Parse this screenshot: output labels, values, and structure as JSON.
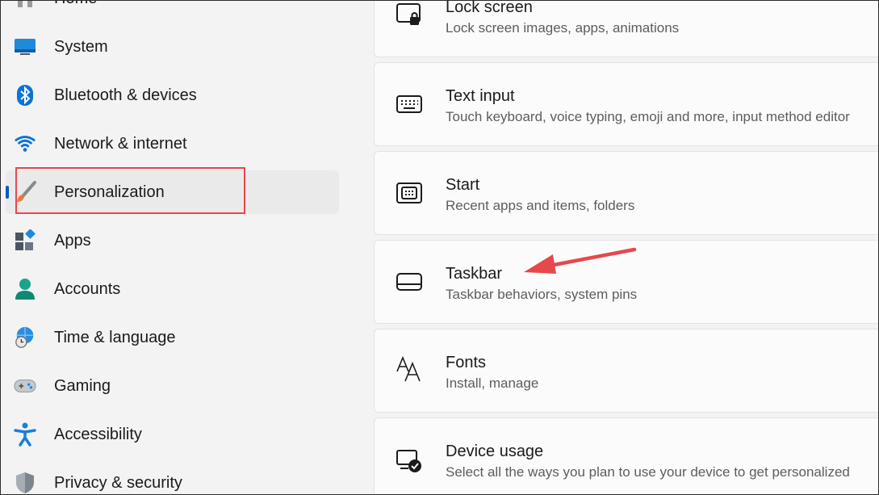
{
  "sidebar": {
    "items": [
      {
        "label": "Home",
        "icon": "home-icon"
      },
      {
        "label": "System",
        "icon": "system-icon"
      },
      {
        "label": "Bluetooth & devices",
        "icon": "bluetooth-icon"
      },
      {
        "label": "Network & internet",
        "icon": "wifi-icon"
      },
      {
        "label": "Personalization",
        "icon": "paintbrush-icon",
        "selected": true
      },
      {
        "label": "Apps",
        "icon": "apps-icon"
      },
      {
        "label": "Accounts",
        "icon": "accounts-icon"
      },
      {
        "label": "Time & language",
        "icon": "globe-clock-icon"
      },
      {
        "label": "Gaming",
        "icon": "gamepad-icon"
      },
      {
        "label": "Accessibility",
        "icon": "accessibility-icon"
      },
      {
        "label": "Privacy & security",
        "icon": "shield-icon"
      }
    ]
  },
  "main": {
    "cards": [
      {
        "title": "Lock screen",
        "description": "Lock screen images, apps, animations",
        "icon": "lock-screen-icon"
      },
      {
        "title": "Text input",
        "description": "Touch keyboard, voice typing, emoji and more, input method editor",
        "icon": "keyboard-icon"
      },
      {
        "title": "Start",
        "description": "Recent apps and items, folders",
        "icon": "start-icon"
      },
      {
        "title": "Taskbar",
        "description": "Taskbar behaviors, system pins",
        "icon": "taskbar-icon"
      },
      {
        "title": "Fonts",
        "description": "Install, manage",
        "icon": "fonts-icon"
      },
      {
        "title": "Device usage",
        "description": "Select all the ways you plan to use your device to get personalized",
        "icon": "device-usage-icon"
      }
    ]
  },
  "annotations": {
    "highlight_color": "#e5484d",
    "arrow_color": "#e5484d"
  }
}
